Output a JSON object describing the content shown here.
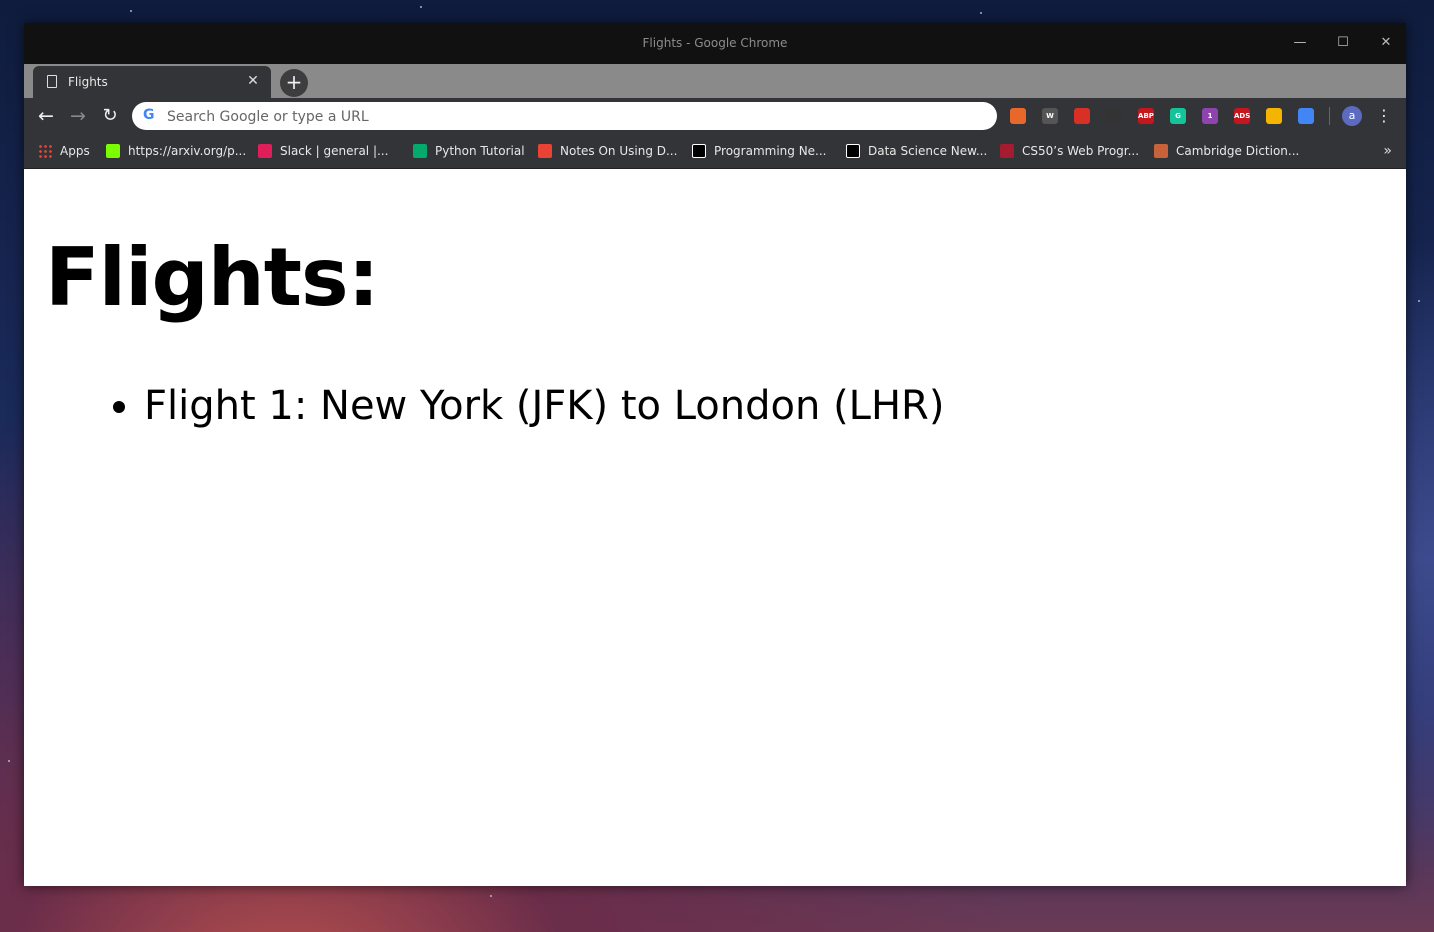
{
  "window": {
    "title": "Flights - Google Chrome"
  },
  "tab": {
    "label": "Flights",
    "close": "✕",
    "new_tab": "+"
  },
  "toolbar": {
    "omnibox_placeholder": "Search Google or type a URL",
    "avatar_letter": "a"
  },
  "extensions": [
    {
      "name": "bar-chart-icon",
      "color": "#e8682c",
      "text": ""
    },
    {
      "name": "w-icon",
      "color": "#555",
      "text": "W"
    },
    {
      "name": "stop-hand-icon",
      "color": "#d93025",
      "text": ""
    },
    {
      "name": "paw-icon",
      "color": "#333",
      "text": ""
    },
    {
      "name": "adblock-plus-icon",
      "color": "#c4161c",
      "text": "ABP"
    },
    {
      "name": "grammarly-icon",
      "color": "#15c39a",
      "text": "G"
    },
    {
      "name": "extension-badge-icon",
      "color": "#8e44ad",
      "text": "1"
    },
    {
      "name": "ads-icon",
      "color": "#c4161c",
      "text": "ADS"
    },
    {
      "name": "color-grid-icon",
      "color": "#f4b400",
      "text": ""
    },
    {
      "name": "window-icon",
      "color": "#4285f4",
      "text": ""
    }
  ],
  "bookmarks": [
    {
      "label": "Apps",
      "icon": "apps-grid-icon",
      "color": "#ea4335"
    },
    {
      "label": "https://arxiv.org/p...",
      "icon": "smiley-icon",
      "color": "#7cfc00"
    },
    {
      "label": "Slack | general |...",
      "icon": "slack-icon",
      "color": "#e01e5a"
    },
    {
      "label": "Python Tutorial",
      "icon": "w3-icon",
      "color": "#04aa6d"
    },
    {
      "label": "Notes On Using D...",
      "icon": "red-square-icon",
      "color": "#ea4335"
    },
    {
      "label": "Programming Ne...",
      "icon": "medium-icon",
      "color": "#ffffff"
    },
    {
      "label": "Data Science New...",
      "icon": "medium-icon",
      "color": "#ffffff"
    },
    {
      "label": "CS50’s Web Progr...",
      "icon": "harvard-icon",
      "color": "#a51c30"
    },
    {
      "label": "Cambridge Diction...",
      "icon": "cambridge-icon",
      "color": "#c8623a"
    }
  ],
  "page": {
    "heading": "Flights:",
    "flights": [
      "Flight 1: New York (JFK) to London (LHR)"
    ]
  }
}
